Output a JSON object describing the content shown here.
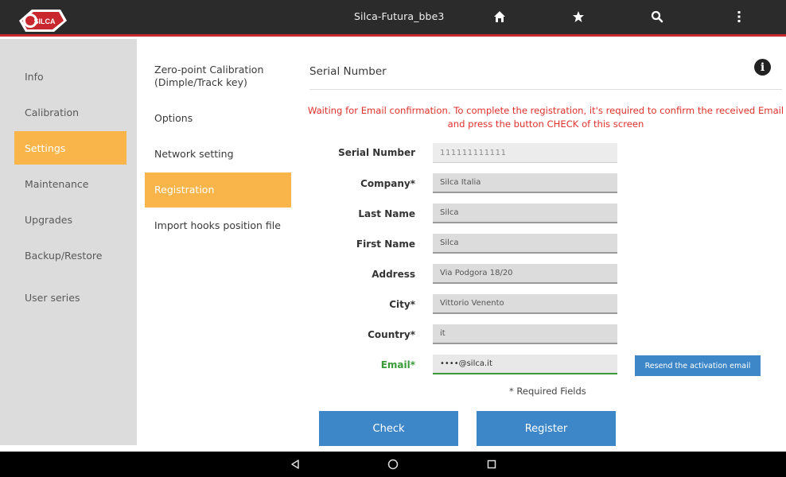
{
  "topbar": {
    "brand": "SILCA",
    "title": "Silca-Futura_bbe3",
    "icons": [
      "home-icon",
      "star-icon",
      "search-icon",
      "more-vertical-icon"
    ]
  },
  "sidebar": {
    "items": [
      {
        "label": "Info",
        "active": false
      },
      {
        "label": "Calibration",
        "active": false
      },
      {
        "label": "Settings",
        "active": true
      },
      {
        "label": "Maintenance",
        "active": false
      },
      {
        "label": "Upgrades",
        "active": false
      },
      {
        "label": "Backup/Restore",
        "active": false
      },
      {
        "label": "User series",
        "active": false
      }
    ]
  },
  "submenu": {
    "items": [
      {
        "label": "Zero-point Calibration (Dimple/Track key)",
        "active": false
      },
      {
        "label": "Options",
        "active": false
      },
      {
        "label": "Network setting",
        "active": false
      },
      {
        "label": "Registration",
        "active": true
      },
      {
        "label": "Import hooks position file",
        "active": false
      }
    ]
  },
  "main": {
    "title": "Serial Number",
    "warning": "Waiting for Email confirmation. To complete the registration, it's required to confirm the received Email and press the button CHECK of this screen",
    "fields": [
      {
        "label": "Serial Number",
        "value": "111111111111"
      },
      {
        "label": "Company*",
        "value": "Silca Italia"
      },
      {
        "label": "Last Name",
        "value": "Silca"
      },
      {
        "label": "First Name",
        "value": "Silca"
      },
      {
        "label": "Address",
        "value": "Via Podgora 18/20"
      },
      {
        "label": "City*",
        "value": "Vittorio Venento"
      },
      {
        "label": "Country*",
        "value": "it"
      },
      {
        "label": "Email*",
        "value": "••••@silca.it"
      }
    ],
    "resend_label": "Resend the activation email",
    "required_note": "* Required Fields",
    "check_label": "Check",
    "register_label": "Register"
  },
  "colors": {
    "accent": "#f9b54a",
    "topbar": "#2b2b2b",
    "brand_red": "#c9272e",
    "button_blue": "#3d87c9",
    "warning_red": "#e0312e",
    "email_green": "#3a9a38"
  },
  "navbar": {
    "icons": [
      "back-icon",
      "home-circle-icon",
      "recents-icon"
    ]
  }
}
